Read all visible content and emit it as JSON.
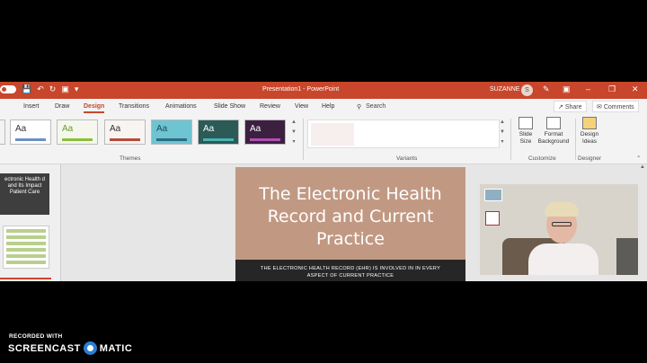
{
  "window": {
    "doc_title": "Presentation1 - PowerPoint",
    "user_name": "SUZANNE",
    "user_initial": "S",
    "accent": "#c8462b",
    "quick_access": [
      "save-icon",
      "undo-icon",
      "redo-icon",
      "customize-icon"
    ],
    "window_controls": [
      "minimize",
      "restore",
      "close"
    ]
  },
  "ribbon_tabs": [
    "Insert",
    "Draw",
    "Design",
    "Transitions",
    "Animations",
    "Slide Show",
    "Review",
    "View",
    "Help"
  ],
  "active_tab": "Design",
  "search_label": "Search",
  "share_label": "Share",
  "comments_label": "Comments",
  "themes": {
    "label": "Themes",
    "items": [
      {
        "aa": "Aa",
        "bg": "#ffffff",
        "color": "#333333",
        "bar": "#6a8fc7"
      },
      {
        "aa": "Aa",
        "bg": "#f5f7ee",
        "color": "#6a9a2a",
        "bar": "#8bbf3b"
      },
      {
        "aa": "Aa",
        "bg": "#f7f4f2",
        "color": "#333333",
        "bar": "#b54b3a"
      },
      {
        "aa": "Aa",
        "bg": "#6ec4d0",
        "color": "#1b4d5a",
        "bar": "#2d6a86"
      },
      {
        "aa": "Aa",
        "bg": "#2b5a57",
        "color": "#ffffff",
        "bar": "#49b3b0"
      },
      {
        "aa": "Aa",
        "bg": "#3b2040",
        "color": "#ffffff",
        "bar": "#b04fb5"
      }
    ]
  },
  "variants_label": "Variants",
  "customize": {
    "label": "Customize",
    "slide_size": "Slide Size",
    "format_background": "Format Background"
  },
  "designer": {
    "label": "Designer",
    "design_ideas": "Design Ideas"
  },
  "thumbnails": {
    "slide1_text": "ectronic Health d and Its Impact Patient Care"
  },
  "slide": {
    "title": "The Electronic Health Record and Current Practice",
    "subtitle": "THE ELECTRONIC HEALTH RECORD (EHR) IS INVOLVED IN IN EVERY ASPECT OF CURRENT PRACTICE"
  },
  "watermark": {
    "recorded_with": "RECORDED WITH",
    "brand_left": "SCREENCAST",
    "brand_right": "MATIC"
  }
}
